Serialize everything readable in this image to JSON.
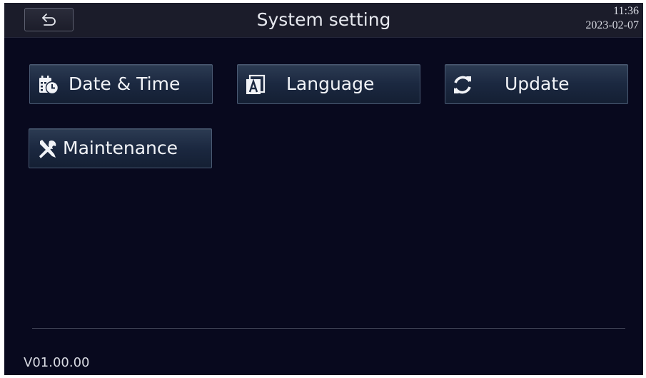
{
  "header": {
    "title": "System setting",
    "time": "11:36",
    "date": "2023-02-07",
    "back_icon": "back-arrow-icon"
  },
  "menu": {
    "items": [
      {
        "label": "Date & Time",
        "icon": "calendar-clock-icon"
      },
      {
        "label": "Language",
        "icon": "language-icon"
      },
      {
        "label": "Update",
        "icon": "refresh-icon"
      },
      {
        "label": "Maintenance",
        "icon": "tools-icon"
      }
    ]
  },
  "footer": {
    "version": "V01.00.00"
  },
  "colors": {
    "background": "#08091e",
    "topbar": "#1b1c2a",
    "tile_top": "#2c3b52",
    "tile_bottom": "#141f33",
    "text": "#f1f3f7"
  }
}
